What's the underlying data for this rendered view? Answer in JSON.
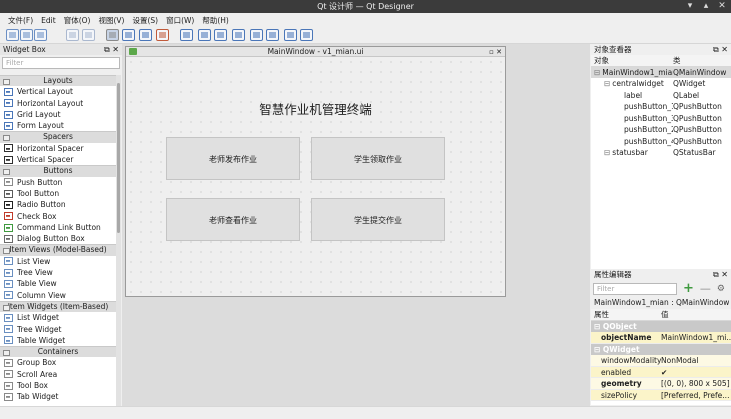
{
  "window": {
    "title": "Qt 设计师 — Qt Designer"
  },
  "menu": [
    "文件(F)",
    "Edit",
    "窗体(O)",
    "视图(V)",
    "设置(S)",
    "窗口(W)",
    "帮助(H)"
  ],
  "widget_box": {
    "title": "Widget Box",
    "filter_placeholder": "Filter",
    "rows": [
      {
        "type": "cat",
        "label": "Layouts"
      },
      {
        "type": "item",
        "label": "Vertical Layout",
        "icon": "vertical-layout-icon",
        "color": "#4a76b8"
      },
      {
        "type": "item",
        "label": "Horizontal Layout",
        "icon": "horizontal-layout-icon",
        "color": "#4a76b8"
      },
      {
        "type": "item",
        "label": "Grid Layout",
        "icon": "grid-layout-icon",
        "color": "#4a76b8"
      },
      {
        "type": "item",
        "label": "Form Layout",
        "icon": "form-layout-icon",
        "color": "#4a76b8"
      },
      {
        "type": "cat",
        "label": "Spacers"
      },
      {
        "type": "item",
        "label": "Horizontal Spacer",
        "icon": "horizontal-spacer-icon",
        "color": "#303030"
      },
      {
        "type": "item",
        "label": "Vertical Spacer",
        "icon": "vertical-spacer-icon",
        "color": "#303030"
      },
      {
        "type": "cat",
        "label": "Buttons"
      },
      {
        "type": "item",
        "label": "Push Button",
        "icon": "push-button-icon",
        "color": "#8a8a8a"
      },
      {
        "type": "item",
        "label": "Tool Button",
        "icon": "tool-button-icon",
        "color": "#5a5a5a"
      },
      {
        "type": "item",
        "label": "Radio Button",
        "icon": "radio-button-icon",
        "color": "#202020"
      },
      {
        "type": "item",
        "label": "Check Box",
        "icon": "check-box-icon",
        "color": "#c03a2a"
      },
      {
        "type": "item",
        "label": "Command Link Button",
        "icon": "command-link-icon",
        "color": "#3f9a3f"
      },
      {
        "type": "item",
        "label": "Dialog Button Box",
        "icon": "dialog-button-box-icon",
        "color": "#6a6a6a"
      },
      {
        "type": "cat",
        "label": "Item Views (Model-Based)"
      },
      {
        "type": "item",
        "label": "List View",
        "icon": "list-view-icon",
        "color": "#6a8fc0"
      },
      {
        "type": "item",
        "label": "Tree View",
        "icon": "tree-view-icon",
        "color": "#6a8fc0"
      },
      {
        "type": "item",
        "label": "Table View",
        "icon": "table-view-icon",
        "color": "#6a8fc0"
      },
      {
        "type": "item",
        "label": "Column View",
        "icon": "column-view-icon",
        "color": "#6a8fc0"
      },
      {
        "type": "cat",
        "label": "Item Widgets (Item-Based)"
      },
      {
        "type": "item",
        "label": "List Widget",
        "icon": "list-widget-icon",
        "color": "#6a8fc0"
      },
      {
        "type": "item",
        "label": "Tree Widget",
        "icon": "tree-widget-icon",
        "color": "#6a8fc0"
      },
      {
        "type": "item",
        "label": "Table Widget",
        "icon": "table-widget-icon",
        "color": "#6a8fc0"
      },
      {
        "type": "cat",
        "label": "Containers"
      },
      {
        "type": "item",
        "label": "Group Box",
        "icon": "group-box-icon",
        "color": "#8a8a8a"
      },
      {
        "type": "item",
        "label": "Scroll Area",
        "icon": "scroll-area-icon",
        "color": "#8a8a8a"
      },
      {
        "type": "item",
        "label": "Tool Box",
        "icon": "tool-box-icon",
        "color": "#8a8a8a"
      },
      {
        "type": "item",
        "label": "Tab Widget",
        "icon": "tab-widget-icon",
        "color": "#8a8a8a"
      }
    ]
  },
  "form": {
    "title": "MainWindow - v1_mian.ui",
    "heading": "智慧作业机管理终端",
    "buttons": [
      "老师发布作业",
      "学生领取作业",
      "老师查看作业",
      "学生提交作业"
    ]
  },
  "object_inspector": {
    "title": "对象查看器",
    "col_object": "对象",
    "col_class": "类",
    "rows": [
      {
        "obj": "MainWindow1_mian",
        "cls": "QMainWindow",
        "level": 0,
        "selected": true
      },
      {
        "obj": "centralwidget",
        "cls": "QWidget",
        "level": 1,
        "selected": false
      },
      {
        "obj": "label",
        "cls": "QLabel",
        "level": 2,
        "selected": false
      },
      {
        "obj": "pushButton_1",
        "cls": "QPushButton",
        "level": 2,
        "selected": false
      },
      {
        "obj": "pushButton_3",
        "cls": "QPushButton",
        "level": 2,
        "selected": false
      },
      {
        "obj": "pushButton_2",
        "cls": "QPushButton",
        "level": 2,
        "selected": false
      },
      {
        "obj": "pushButton_4",
        "cls": "QPushButton",
        "level": 2,
        "selected": false
      },
      {
        "obj": "statusbar",
        "cls": "QStatusBar",
        "level": 1,
        "selected": false
      }
    ]
  },
  "property_editor": {
    "title": "属性编辑器",
    "filter_placeholder": "Filter",
    "context": "MainWindow1_mian : QMainWindow",
    "col_property": "属性",
    "col_value": "值",
    "rows": [
      {
        "type": "section",
        "name": "QObject",
        "value": ""
      },
      {
        "type": "prop",
        "name": "objectName",
        "value": "MainWindow1_mi...",
        "bold": true,
        "bg": "#fbf4c9"
      },
      {
        "type": "section",
        "name": "QWidget",
        "value": ""
      },
      {
        "type": "prop",
        "name": "windowModality",
        "value": "NonModal",
        "bold": false,
        "bg": "#fdf9e4"
      },
      {
        "type": "prop",
        "name": "enabled",
        "value": "✔",
        "bold": false,
        "bg": "#fbf4c9"
      },
      {
        "type": "prop",
        "name": "geometry",
        "value": "[(0, 0), 800 x 505]",
        "bold": true,
        "bg": "#fdf9e4"
      },
      {
        "type": "prop",
        "name": "sizePolicy",
        "value": "[Preferred, Prefe...",
        "bold": false,
        "bg": "#fbf4c9"
      }
    ]
  }
}
